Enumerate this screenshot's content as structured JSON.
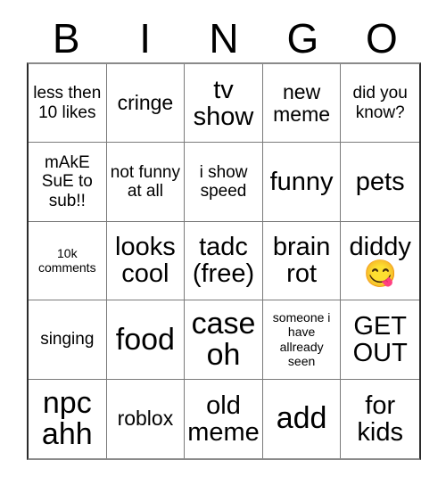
{
  "card": {
    "title": "BINGO",
    "header_letters": [
      "B",
      "I",
      "N",
      "G",
      "O"
    ],
    "grid_size": "5x5",
    "background_color": "#ffffff",
    "text_color": "#000000",
    "border_color": "#7a7a7a",
    "cells": [
      {
        "id": "b1",
        "text": "less then 10 likes",
        "size": "sm"
      },
      {
        "id": "i1",
        "text": "cringe",
        "size": "md"
      },
      {
        "id": "n1",
        "text": "tv show",
        "size": "lg"
      },
      {
        "id": "g1",
        "text": "new meme",
        "size": "md"
      },
      {
        "id": "o1",
        "text": "did you know?",
        "size": "sm"
      },
      {
        "id": "b2",
        "text": "mAkE SuE to sub!!",
        "size": "sm"
      },
      {
        "id": "i2",
        "text": "not funny at all",
        "size": "sm"
      },
      {
        "id": "n2",
        "text": "i show speed",
        "size": "sm"
      },
      {
        "id": "g2",
        "text": "funny",
        "size": "lg"
      },
      {
        "id": "o2",
        "text": "pets",
        "size": "lg"
      },
      {
        "id": "b3",
        "text": "10k comments",
        "size": "xs"
      },
      {
        "id": "i3",
        "text": "looks cool",
        "size": "lg"
      },
      {
        "id": "n3",
        "text": "tadc (free)",
        "size": "lg"
      },
      {
        "id": "g3",
        "text": "brain rot",
        "size": "lg"
      },
      {
        "id": "o3",
        "text": "diddy",
        "size": "lg",
        "emoji": "😋",
        "emoji_name": "face-savoring-food-emoji"
      },
      {
        "id": "b4",
        "text": "singing",
        "size": "sm"
      },
      {
        "id": "i4",
        "text": "food",
        "size": "xl"
      },
      {
        "id": "n4",
        "text": "case oh",
        "size": "xl"
      },
      {
        "id": "g4",
        "text": "someone i have allready seen",
        "size": "xs"
      },
      {
        "id": "o4",
        "text": "GET OUT",
        "size": "lg"
      },
      {
        "id": "b5",
        "text": "npc ahh",
        "size": "xl"
      },
      {
        "id": "i5",
        "text": "roblox",
        "size": "md"
      },
      {
        "id": "n5",
        "text": "old meme",
        "size": "lg"
      },
      {
        "id": "g5",
        "text": "add",
        "size": "xl"
      },
      {
        "id": "o5",
        "text": "for kids",
        "size": "lg"
      }
    ]
  }
}
